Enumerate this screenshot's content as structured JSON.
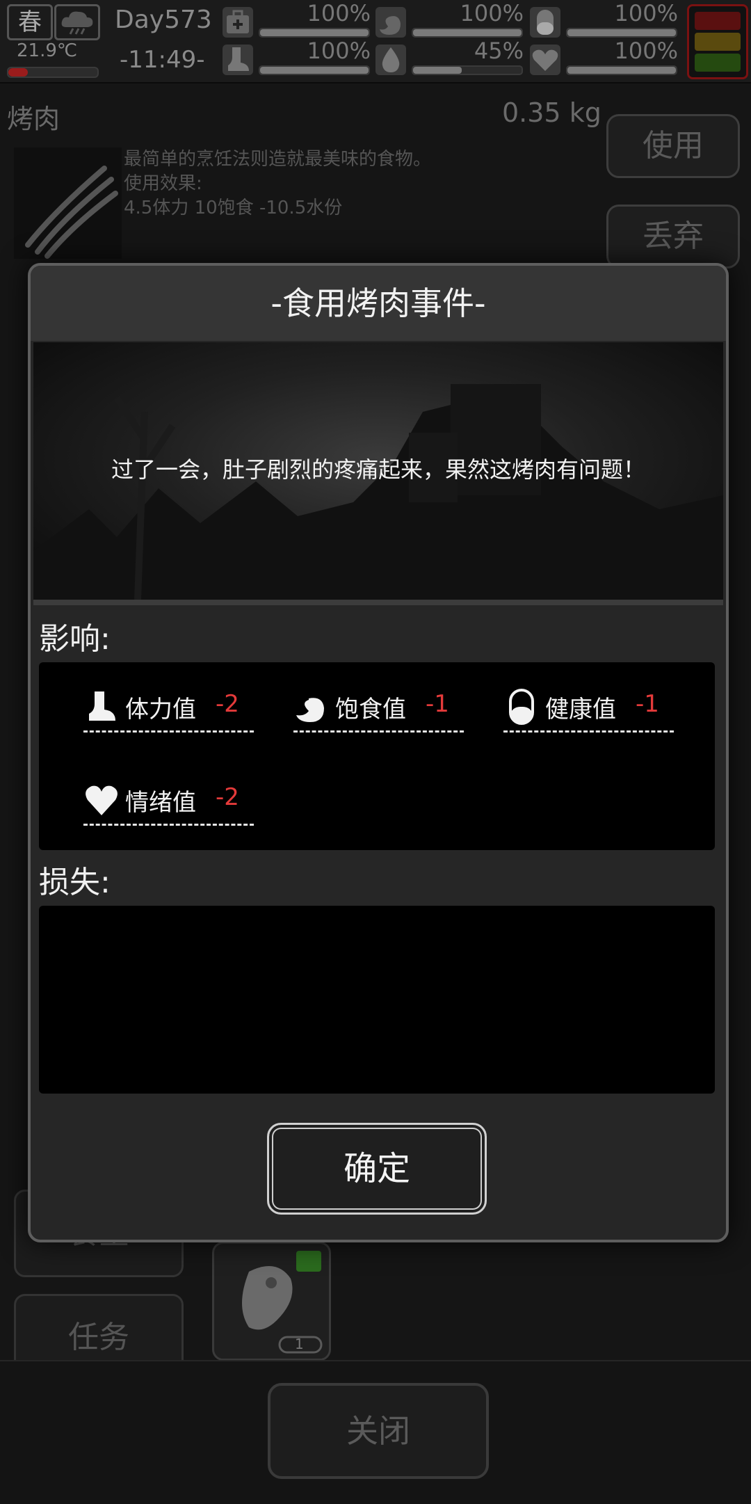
{
  "status": {
    "season": "春",
    "temperature": "21.9℃",
    "day": "Day573",
    "time": "-11:49-",
    "stats": [
      {
        "name": "medkit",
        "icon": "medkit-icon",
        "value_label": "100%",
        "level": 1.0
      },
      {
        "name": "hunger",
        "icon": "stomach-icon",
        "value_label": "100%",
        "level": 1.0
      },
      {
        "name": "health",
        "icon": "pill-icon",
        "value_label": "100%",
        "level": 1.0
      },
      {
        "name": "stamina",
        "icon": "boot-icon",
        "value_label": "100%",
        "level": 1.0
      },
      {
        "name": "water",
        "icon": "water-drop-icon",
        "value_label": "45%",
        "level": 0.45
      },
      {
        "name": "mood",
        "icon": "heart-icon",
        "value_label": "100%",
        "level": 1.0
      }
    ]
  },
  "item": {
    "name": "烤肉",
    "weight": "0.35 kg",
    "desc_line1": "最简单的烹饪法则造就最美味的食物。",
    "desc_line2": "使用效果:",
    "desc_line3": "4.5体力 10饱食 -10.5水份",
    "use_label": "使用",
    "discard_label": "丢弃"
  },
  "background": {
    "left_btn_1": "食堂",
    "left_btn_2": "任务",
    "slot_count": "1",
    "close_label": "关闭"
  },
  "modal": {
    "title": "-食用烤肉事件-",
    "message": "过了一会，肚子剧烈的疼痛起来，果然这烤肉有问题！",
    "effects_label": "影响:",
    "losses_label": "损失:",
    "effects": [
      {
        "icon": "boot-icon",
        "name": "体力值",
        "value": "-2"
      },
      {
        "icon": "stomach-icon",
        "name": "饱食值",
        "value": "-1"
      },
      {
        "icon": "pill-icon",
        "name": "健康值",
        "value": "-1"
      },
      {
        "icon": "heart-icon",
        "name": "情绪值",
        "value": "-2"
      }
    ],
    "confirm_label": "确定"
  },
  "colors": {
    "negative": "#e43a3a",
    "panel": "#262626",
    "signal_red": "#7a1111",
    "signal_yellow": "#6b5a10",
    "signal_green": "#2d5a12"
  }
}
